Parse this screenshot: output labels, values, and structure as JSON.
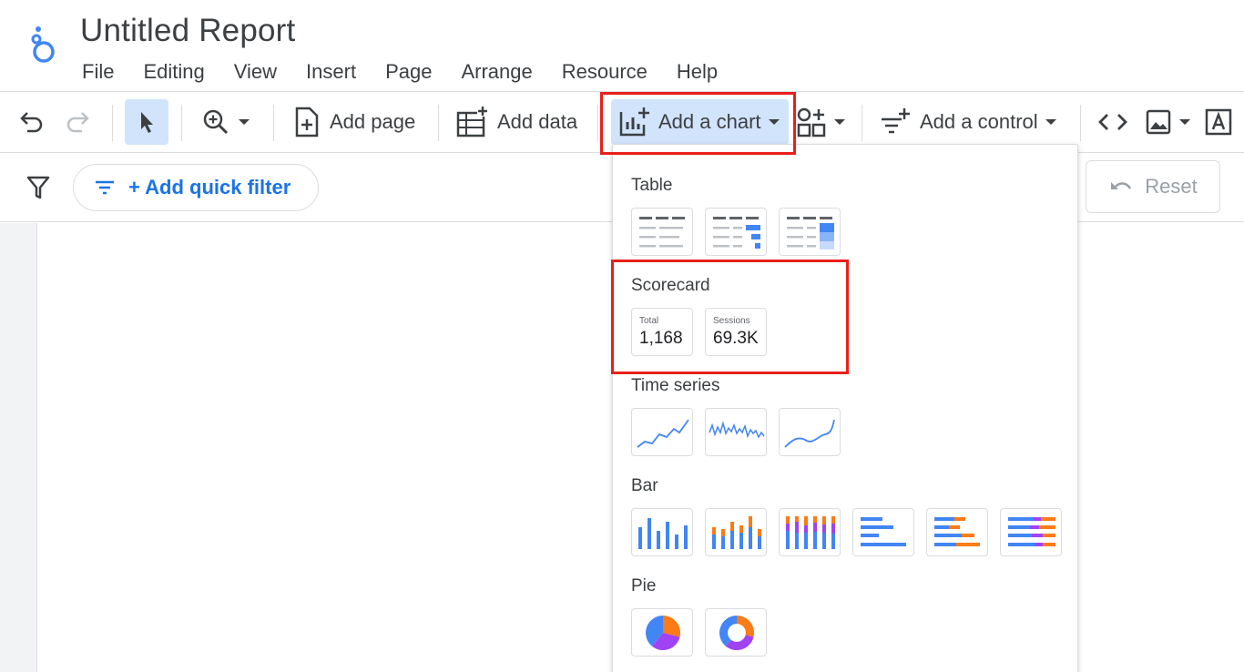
{
  "app": {
    "title": "Untitled Report",
    "menu": [
      "File",
      "Editing",
      "View",
      "Insert",
      "Page",
      "Arrange",
      "Resource",
      "Help"
    ]
  },
  "toolbar": {
    "add_page": "Add page",
    "add_data": "Add data",
    "add_chart": "Add a chart",
    "add_control": "Add a control"
  },
  "filterbar": {
    "quick_filter": "+ Add quick filter",
    "reset": "Reset"
  },
  "chart_menu": {
    "sections": {
      "table": "Table",
      "scorecard": "Scorecard",
      "time_series": "Time series",
      "bar": "Bar",
      "pie": "Pie"
    },
    "scorecards": [
      {
        "label": "Total",
        "value": "1,168"
      },
      {
        "label": "Sessions",
        "value": "69.3K"
      }
    ]
  },
  "colors": {
    "accent": "#1a73e8",
    "highlight": "#e8201a",
    "selected_bg": "#d2e3fc",
    "chart_blue": "#4285f4",
    "chart_orange": "#fa7b17",
    "chart_purple": "#a142f4"
  }
}
